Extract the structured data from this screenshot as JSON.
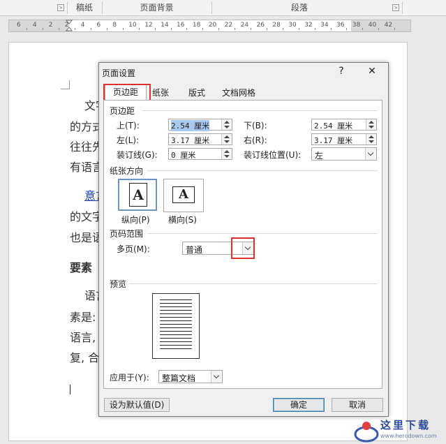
{
  "ribbon": {
    "groups": [
      "稿纸",
      "页面背景",
      "段落"
    ]
  },
  "ruler": {
    "numbers": [
      "6",
      "4",
      "2",
      "2",
      "4",
      "6",
      "8",
      "10",
      "12",
      "14",
      "16",
      "18",
      "20",
      "22",
      "24",
      "26",
      "28",
      "30",
      "32",
      "34",
      "36",
      "38",
      "40",
      "42"
    ]
  },
  "document": {
    "lines": [
      "文字",
      "的方式",
      "往往先",
      "有语言",
      "意言",
      "的文字",
      "也是语",
      "要素",
      "语言",
      "素是:",
      "语言,",
      "复, 合"
    ],
    "heading": "要素"
  },
  "dialog": {
    "title": "页面设置",
    "help": "?",
    "close": "✕",
    "tabs": [
      "页边距",
      "纸张",
      "版式",
      "文档网格"
    ],
    "margins": {
      "section": "页边距",
      "top_label": "上(T):",
      "top_value": "2.54 厘米",
      "bottom_label": "下(B):",
      "bottom_value": "2.54 厘米",
      "left_label": "左(L):",
      "left_value": "3.17 厘米",
      "right_label": "右(R):",
      "right_value": "3.17 厘米",
      "gutter_label": "装订线(G):",
      "gutter_value": "0 厘米",
      "gutter_pos_label": "装订线位置(U):",
      "gutter_pos_value": "左"
    },
    "orientation": {
      "section": "纸张方向",
      "portrait": "纵向(P)",
      "landscape": "横向(S)",
      "glyph": "A"
    },
    "pages": {
      "section": "页码范围",
      "multi_label": "多页(M):",
      "multi_value": "普通"
    },
    "preview": {
      "section": "预览"
    },
    "apply": {
      "label": "应用于(Y):",
      "value": "整篇文档"
    },
    "buttons": {
      "default": "设为默认值(D)",
      "ok": "确定",
      "cancel": "取消"
    }
  },
  "watermark": {
    "text": "这里下载",
    "url": "www.herodown.com"
  },
  "colors": {
    "highlight": "#e03030",
    "link": "#1f3fb0",
    "selection": "#a8c8ef"
  }
}
